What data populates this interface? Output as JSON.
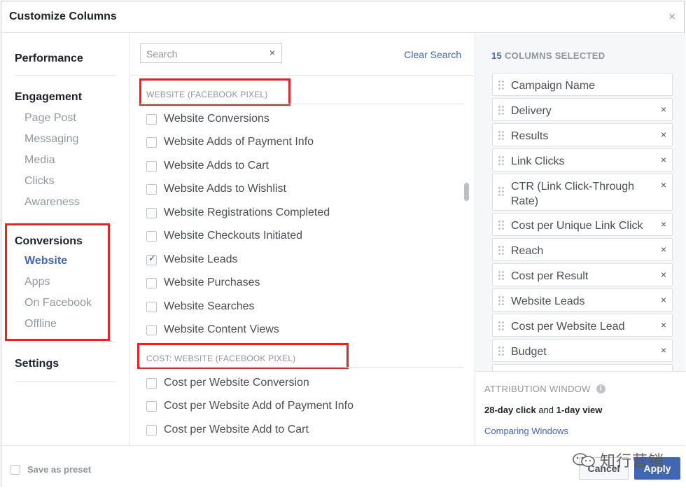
{
  "dialog": {
    "title": "Customize Columns",
    "close_icon": "×"
  },
  "nav": {
    "groups": [
      {
        "label": "Performance",
        "items": []
      },
      {
        "label": "Engagement",
        "items": [
          "Page Post",
          "Messaging",
          "Media",
          "Clicks",
          "Awareness"
        ]
      },
      {
        "label": "Conversions",
        "items": [
          "Website",
          "Apps",
          "On Facebook",
          "Offline"
        ],
        "active": "Website"
      },
      {
        "label": "Settings",
        "items": []
      }
    ]
  },
  "search": {
    "placeholder": "Search",
    "value": "",
    "clear_icon": "×",
    "clear_link": "Clear Search"
  },
  "sections": [
    {
      "title": "WEBSITE (FACEBOOK PIXEL)",
      "options": [
        {
          "label": "Website Conversions",
          "checked": false
        },
        {
          "label": "Website Adds of Payment Info",
          "checked": false
        },
        {
          "label": "Website Adds to Cart",
          "checked": false
        },
        {
          "label": "Website Adds to Wishlist",
          "checked": false
        },
        {
          "label": "Website Registrations Completed",
          "checked": false
        },
        {
          "label": "Website Checkouts Initiated",
          "checked": false
        },
        {
          "label": "Website Leads",
          "checked": true
        },
        {
          "label": "Website Purchases",
          "checked": false
        },
        {
          "label": "Website Searches",
          "checked": false
        },
        {
          "label": "Website Content Views",
          "checked": false
        }
      ]
    },
    {
      "title": "COST: WEBSITE (FACEBOOK PIXEL)",
      "options": [
        {
          "label": "Cost per Website Conversion",
          "checked": false
        },
        {
          "label": "Cost per Website Add of Payment Info",
          "checked": false
        },
        {
          "label": "Cost per Website Add to Cart",
          "checked": false
        }
      ]
    }
  ],
  "selected": {
    "count": "15",
    "heading": "COLUMNS SELECTED",
    "columns": [
      {
        "label": "Campaign Name",
        "removable": false
      },
      {
        "label": "Delivery",
        "removable": true
      },
      {
        "label": "Results",
        "removable": true
      },
      {
        "label": "Link Clicks",
        "removable": true
      },
      {
        "label": "CTR (Link Click-Through Rate)",
        "removable": true
      },
      {
        "label": "Cost per Unique Link Click",
        "removable": true
      },
      {
        "label": "Reach",
        "removable": true
      },
      {
        "label": "Cost per Result",
        "removable": true
      },
      {
        "label": "Website Leads",
        "removable": true
      },
      {
        "label": "Cost per Website Lead",
        "removable": true
      },
      {
        "label": "Budget",
        "removable": true
      },
      {
        "label": "",
        "removable": false
      }
    ],
    "remove_icon": "×"
  },
  "attribution": {
    "heading": "ATTRIBUTION WINDOW",
    "info_icon": "i",
    "click_window": "28-day click",
    "joiner": " and ",
    "view_window": "1-day view",
    "link": "Comparing Windows"
  },
  "footer": {
    "preset_label": "Save as preset",
    "cancel_label": "Cancel",
    "apply_label": "Apply"
  },
  "watermark": {
    "text": "知行营销"
  },
  "colors": {
    "accent": "#4267b2",
    "highlight": "#e0262b",
    "muted": "#90949c"
  }
}
